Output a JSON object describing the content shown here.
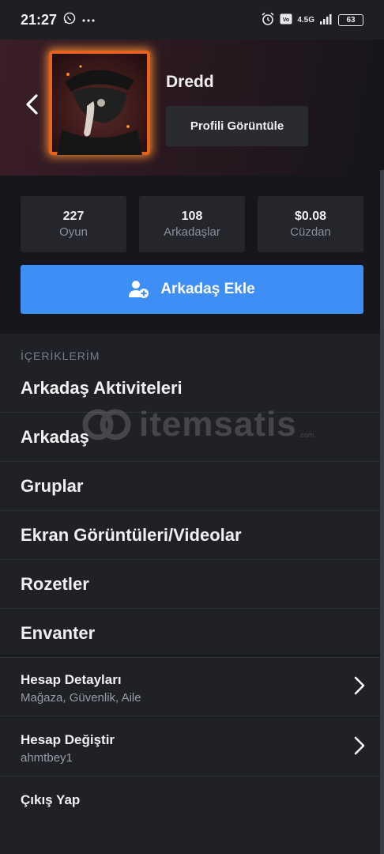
{
  "status_bar": {
    "time": "21:27",
    "network": "4.5G",
    "battery": "63"
  },
  "profile": {
    "name": "Dredd",
    "view_profile_label": "Profili Görüntüle"
  },
  "stats": [
    {
      "value": "227",
      "label": "Oyun"
    },
    {
      "value": "108",
      "label": "Arkadaşlar"
    },
    {
      "value": "$0.08",
      "label": "Cüzdan"
    }
  ],
  "add_friend_label": "Arkadaş Ekle",
  "section_title": "İÇERİKLERİM",
  "menu": [
    {
      "label": "Arkadaş Aktiviteleri"
    },
    {
      "label": "Arkadaş"
    },
    {
      "label": "Gruplar"
    },
    {
      "label": "Ekran Görüntüleri/Videolar"
    },
    {
      "label": "Rozetler"
    },
    {
      "label": "Envanter"
    }
  ],
  "account_details": {
    "title": "Hesap Detayları",
    "subtitle": "Mağaza, Güvenlik, Aile"
  },
  "switch_account": {
    "title": "Hesap Değiştir",
    "subtitle": "ahmtbey1"
  },
  "logout_label": "Çıkış Yap",
  "watermark": {
    "text": "itemsatis",
    "domain": ".com"
  },
  "colors": {
    "accent": "#3d8ef5",
    "background": "#1f2127",
    "panel": "#16171c",
    "tile": "#24262c"
  },
  "icons": [
    "whatsapp-icon",
    "more-dots-icon",
    "alarm-icon",
    "volte-icon",
    "signal-icon",
    "battery-icon",
    "back-arrow-icon",
    "add-user-icon",
    "chevron-right-icon"
  ]
}
